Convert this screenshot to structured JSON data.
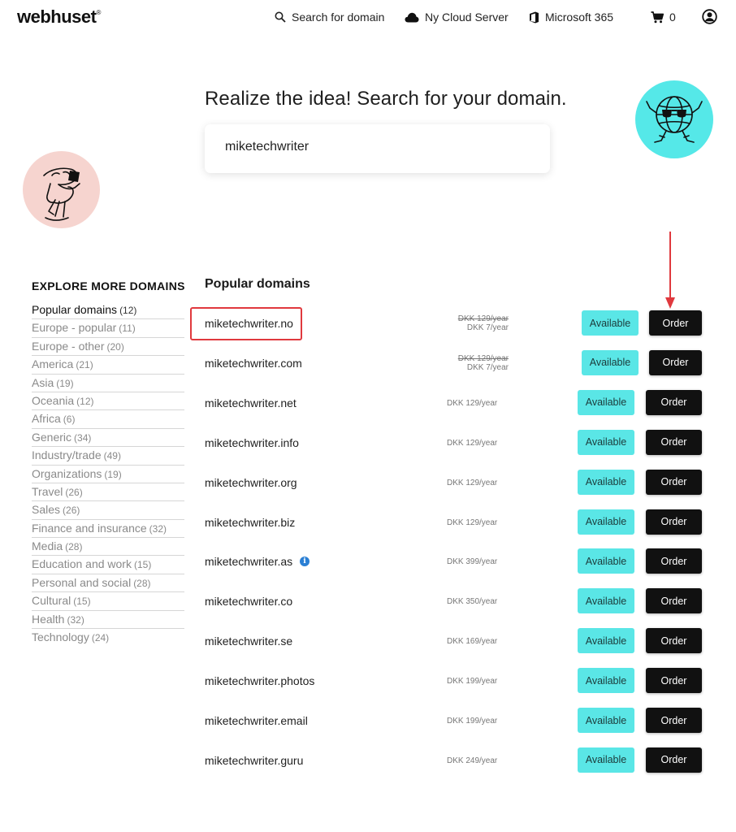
{
  "header": {
    "logo": "webhuset",
    "logo_mark": "®",
    "nav": [
      {
        "icon": "search-icon",
        "label": "Search for domain"
      },
      {
        "icon": "cloud-icon",
        "label": "Ny Cloud Server"
      },
      {
        "icon": "office-icon",
        "label": "Microsoft 365"
      }
    ],
    "cart_count": "0"
  },
  "hero": {
    "title": "Realize the idea! Search for your domain.",
    "search_value": "miketechwriter"
  },
  "sidebar": {
    "title": "EXPLORE MORE DOMAINS",
    "items": [
      {
        "label": "Popular domains",
        "count": "(12)",
        "active": true
      },
      {
        "label": "Europe - popular",
        "count": "(11)"
      },
      {
        "label": "Europe - other",
        "count": "(20)"
      },
      {
        "label": "America",
        "count": "(21)"
      },
      {
        "label": "Asia",
        "count": "(19)"
      },
      {
        "label": "Oceania",
        "count": "(12)"
      },
      {
        "label": "Africa",
        "count": "(6)"
      },
      {
        "label": "Generic",
        "count": "(34)"
      },
      {
        "label": "Industry/trade",
        "count": "(49)"
      },
      {
        "label": "Organizations",
        "count": "(19)"
      },
      {
        "label": "Travel",
        "count": "(26)"
      },
      {
        "label": "Sales",
        "count": "(26)"
      },
      {
        "label": "Finance and insurance",
        "count": "(32)"
      },
      {
        "label": "Media",
        "count": "(28)"
      },
      {
        "label": "Education and work",
        "count": "(15)"
      },
      {
        "label": "Personal and social",
        "count": "(28)"
      },
      {
        "label": "Cultural",
        "count": "(15)"
      },
      {
        "label": "Health",
        "count": "(32)"
      },
      {
        "label": "Technology",
        "count": "(24)"
      }
    ]
  },
  "domains": {
    "title": "Popular domains",
    "available_label": "Available",
    "order_label": "Order",
    "rows": [
      {
        "name": "miketechwriter.no",
        "old_price": "DKK 129/year",
        "price": "DKK 7/year"
      },
      {
        "name": "miketechwriter.com",
        "old_price": "DKK 129/year",
        "price": "DKK 7/year"
      },
      {
        "name": "miketechwriter.net",
        "price": "DKK 129/year"
      },
      {
        "name": "miketechwriter.info",
        "price": "DKK 129/year"
      },
      {
        "name": "miketechwriter.org",
        "price": "DKK 129/year"
      },
      {
        "name": "miketechwriter.biz",
        "price": "DKK 129/year"
      },
      {
        "name": "miketechwriter.as",
        "price": "DKK 399/year",
        "info": "i"
      },
      {
        "name": "miketechwriter.co",
        "price": "DKK 350/year"
      },
      {
        "name": "miketechwriter.se",
        "price": "DKK 169/year"
      },
      {
        "name": "miketechwriter.photos",
        "price": "DKK 199/year"
      },
      {
        "name": "miketechwriter.email",
        "price": "DKK 199/year"
      },
      {
        "name": "miketechwriter.guru",
        "price": "DKK 249/year"
      }
    ]
  },
  "colors": {
    "accent_cyan": "#5ae6e6",
    "order_black": "#111111",
    "annotation_red": "#e0393e",
    "illustration_pink": "#f6d4cf"
  }
}
